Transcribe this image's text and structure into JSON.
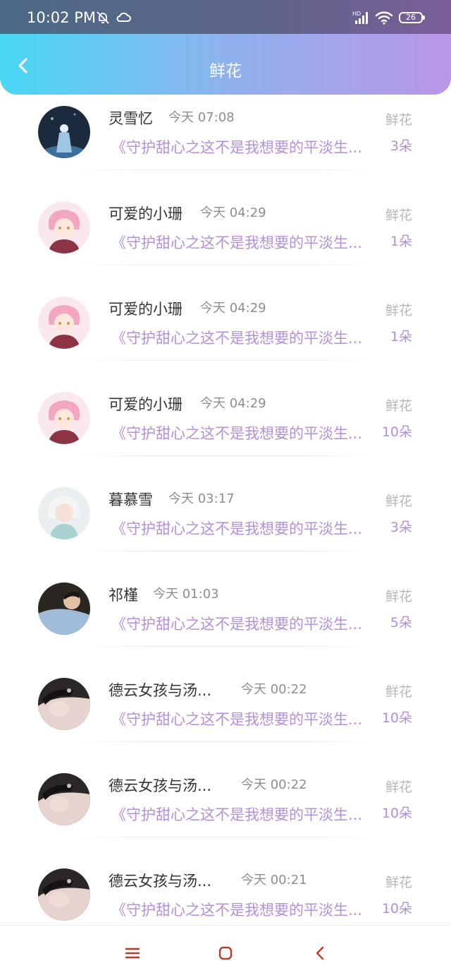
{
  "status_bar": {
    "time": "10:02 PM",
    "icons": [
      "bell-muted-icon",
      "cloud-icon",
      "hd-signal-icon",
      "wifi-icon",
      "battery-icon"
    ],
    "battery": "26"
  },
  "header": {
    "title": "鲜花",
    "back_icon": "chevron-left-icon",
    "gradient": [
      "#47d8f4",
      "#b996e6"
    ]
  },
  "colors": {
    "accent_purple": "#b490db",
    "name_text": "#333333",
    "time_text": "#8e8e8e",
    "gift_type_text": "#b7b7b7"
  },
  "gifts": [
    {
      "name": "灵雪忆",
      "time": "今天 07:08",
      "book": "《守护甜心之这不是我想要的平淡生...",
      "type": "鲜花",
      "count": "3朵"
    },
    {
      "name": "可爱的小珊",
      "time": "今天 04:29",
      "book": "《守护甜心之这不是我想要的平淡生...",
      "type": "鲜花",
      "count": "1朵"
    },
    {
      "name": "可爱的小珊",
      "time": "今天 04:29",
      "book": "《守护甜心之这不是我想要的平淡生...",
      "type": "鲜花",
      "count": "1朵"
    },
    {
      "name": "可爱的小珊",
      "time": "今天 04:29",
      "book": "《守护甜心之这不是我想要的平淡生...",
      "type": "鲜花",
      "count": "10朵"
    },
    {
      "name": "暮慕雪",
      "time": "今天 03:17",
      "book": "《守护甜心之这不是我想要的平淡生...",
      "type": "鲜花",
      "count": "3朵"
    },
    {
      "name": "祁槿",
      "time": "今天 01:03",
      "book": "《守护甜心之这不是我想要的平淡生...",
      "type": "鲜花",
      "count": "5朵"
    },
    {
      "name": "德云女孩与汤...",
      "time": "今天 00:22",
      "book": "《守护甜心之这不是我想要的平淡生...",
      "type": "鲜花",
      "count": "10朵"
    },
    {
      "name": "德云女孩与汤...",
      "time": "今天 00:22",
      "book": "《守护甜心之这不是我想要的平淡生...",
      "type": "鲜花",
      "count": "10朵"
    },
    {
      "name": "德云女孩与汤...",
      "time": "今天 00:21",
      "book": "《守护甜心之这不是我想要的平淡生...",
      "type": "鲜花",
      "count": "10朵"
    }
  ],
  "system_nav": {
    "icons": [
      "menu-icon",
      "home-icon",
      "back-icon"
    ],
    "color": "#c0392b"
  }
}
